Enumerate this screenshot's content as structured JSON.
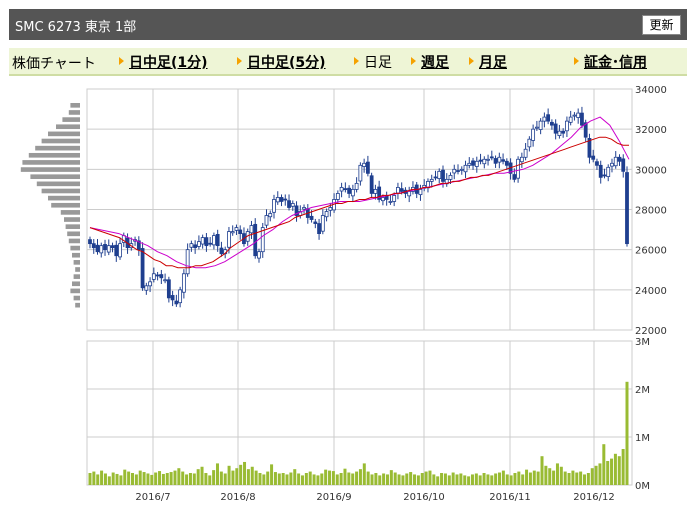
{
  "header": {
    "title": "SMC  6273  東京 1部",
    "refresh_label": "更新"
  },
  "nav": {
    "label": "株価チャート",
    "items": [
      {
        "label": "日中足(1分)",
        "link": true
      },
      {
        "label": "日中足(5分)",
        "link": true
      },
      {
        "label": "日足",
        "link": false
      },
      {
        "label": "週足",
        "link": true
      },
      {
        "label": "月足",
        "link": true
      },
      {
        "label": "証金･信用",
        "link": true
      }
    ]
  },
  "colors": {
    "candle": "#1f3f8f",
    "ma_short": "#cc0000",
    "ma_long": "#cc00cc",
    "volume": "#99bb33",
    "profile": "#999999",
    "grid": "#cccccc"
  },
  "chart_data": [
    {
      "type": "candlestick",
      "title": "",
      "ylim": [
        22000,
        34000
      ],
      "y_ticks": [
        "34000",
        "32000",
        "30000",
        "28000",
        "26000",
        "24000",
        "22000"
      ],
      "x_ticks": [
        "2016/7",
        "2016/8",
        "2016/9",
        "2016/10",
        "2016/11",
        "2016/12"
      ],
      "close": [
        26300,
        26100,
        25900,
        26200,
        26000,
        26200,
        26100,
        25700,
        26300,
        26700,
        26100,
        26300,
        26500,
        26000,
        24100,
        24200,
        24400,
        24800,
        24700,
        24600,
        24500,
        23600,
        23500,
        23300,
        24000,
        24800,
        26000,
        26300,
        26100,
        26400,
        26600,
        26200,
        26300,
        26700,
        26200,
        25800,
        26000,
        26900,
        26900,
        27100,
        26800,
        26300,
        26900,
        27200,
        25700,
        25900,
        27100,
        27700,
        27800,
        28500,
        28600,
        28400,
        28500,
        28100,
        28300,
        27700,
        27900,
        28100,
        27600,
        27500,
        27300,
        26800,
        27700,
        27900,
        28100,
        28500,
        28800,
        29100,
        29000,
        28800,
        29000,
        29300,
        30200,
        30300,
        29800,
        28800,
        29000,
        28500,
        28600,
        28500,
        28400,
        28700,
        29100,
        28900,
        28800,
        28900,
        29100,
        28800,
        29000,
        29200,
        29400,
        29500,
        29600,
        29900,
        29400,
        29500,
        29700,
        30000,
        29900,
        30000,
        30200,
        30300,
        30200,
        30400,
        30400,
        30500,
        30500,
        30600,
        30300,
        30600,
        30400,
        30200,
        29800,
        29500,
        30500,
        30600,
        31000,
        31500,
        32000,
        32100,
        32400,
        32600,
        32400,
        32200,
        31800,
        31900,
        31800,
        32400,
        32600,
        32700,
        32800,
        32200,
        31600,
        30600,
        30500,
        30200,
        29600,
        29700,
        30100,
        30300,
        30600,
        30400,
        29900,
        26300
      ],
      "ma_short": [
        27100,
        27000,
        26900,
        26800,
        26700,
        26600,
        26400,
        26200,
        26000,
        25900,
        25700,
        25500,
        25400,
        25200,
        25200,
        25100,
        25100,
        25100,
        25200,
        25200,
        25300,
        25400,
        25600,
        25800,
        26100,
        26300,
        26500,
        26700,
        26800,
        26900,
        27000,
        27100,
        27200,
        27300,
        27400,
        27600,
        27700,
        27800,
        27900,
        28000,
        28100,
        28200,
        28300,
        28300,
        28400,
        28400,
        28500,
        28500,
        28600,
        28600,
        28700,
        28700,
        28800,
        28800,
        28900,
        29000,
        29000,
        29100,
        29100,
        29200,
        29300,
        29300,
        29400,
        29400,
        29500,
        29600,
        29600,
        29700,
        29700,
        29800,
        29900,
        30000,
        30100,
        30200,
        30300,
        30400,
        30500,
        30600,
        30700,
        30800,
        30900,
        31000,
        31100,
        31200,
        31300,
        31400,
        31500,
        31600,
        31600,
        31500,
        31300,
        31200,
        31200
      ],
      "ma_long": [
        27100,
        27000,
        26900,
        26800,
        26600,
        26400,
        26200,
        25900,
        25700,
        25400,
        25200,
        25100,
        25100,
        25200,
        25400,
        25700,
        26000,
        26300,
        26700,
        27000,
        27400,
        27700,
        27900,
        28100,
        28200,
        28300,
        28400,
        28400,
        28400,
        28500,
        28600,
        28700,
        28800,
        28900,
        29000,
        29100,
        29200,
        29300,
        29400,
        29500,
        29600,
        29700,
        29800,
        29800,
        29900,
        30000,
        30200,
        30500,
        30800,
        31200,
        31600,
        32100,
        32400,
        32600,
        32200,
        31400,
        30500
      ]
    },
    {
      "type": "bar",
      "title": "",
      "ylim": [
        0,
        3000000
      ],
      "y_ticks": [
        "3M",
        "2M",
        "1M",
        "0M"
      ],
      "values": [
        0.25,
        0.28,
        0.22,
        0.3,
        0.24,
        0.18,
        0.26,
        0.23,
        0.2,
        0.32,
        0.28,
        0.25,
        0.22,
        0.3,
        0.27,
        0.24,
        0.21,
        0.26,
        0.29,
        0.23,
        0.25,
        0.27,
        0.3,
        0.35,
        0.28,
        0.22,
        0.25,
        0.24,
        0.33,
        0.38,
        0.25,
        0.2,
        0.31,
        0.45,
        0.28,
        0.24,
        0.4,
        0.3,
        0.35,
        0.42,
        0.48,
        0.33,
        0.38,
        0.3,
        0.25,
        0.22,
        0.28,
        0.43,
        0.27,
        0.24,
        0.25,
        0.22,
        0.26,
        0.33,
        0.24,
        0.2,
        0.25,
        0.28,
        0.22,
        0.2,
        0.24,
        0.32,
        0.3,
        0.29,
        0.22,
        0.25,
        0.34,
        0.26,
        0.24,
        0.28,
        0.33,
        0.45,
        0.28,
        0.22,
        0.25,
        0.2,
        0.24,
        0.22,
        0.31,
        0.26,
        0.22,
        0.2,
        0.24,
        0.27,
        0.22,
        0.2,
        0.25,
        0.28,
        0.3,
        0.22,
        0.18,
        0.25,
        0.24,
        0.2,
        0.26,
        0.22,
        0.24,
        0.2,
        0.18,
        0.22,
        0.24,
        0.2,
        0.25,
        0.22,
        0.2,
        0.24,
        0.26,
        0.3,
        0.22,
        0.2,
        0.25,
        0.28,
        0.22,
        0.32,
        0.26,
        0.3,
        0.28,
        0.6,
        0.4,
        0.35,
        0.3,
        0.45,
        0.38,
        0.28,
        0.25,
        0.3,
        0.26,
        0.28,
        0.22,
        0.25,
        0.35,
        0.4,
        0.45,
        0.85,
        0.5,
        0.55,
        0.65,
        0.6,
        0.75,
        2.15
      ]
    }
  ],
  "price_profile": [
    0.3,
    0.35,
    0.55,
    0.75,
    1.0,
    1.2,
    1.4,
    1.6,
    1.8,
    1.85,
    1.55,
    1.35,
    1.2,
    1.0,
    0.9,
    0.6,
    0.5,
    0.45,
    0.4,
    0.35,
    0.3,
    0.25,
    0.2,
    0.15,
    0.2,
    0.25,
    0.3,
    0.2,
    0.15
  ]
}
